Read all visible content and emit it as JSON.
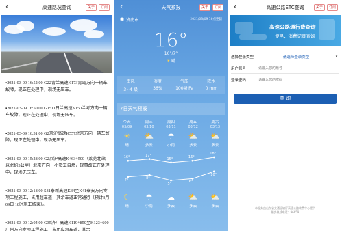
{
  "panel1": {
    "title": "高速路况查询",
    "follow_label": "关于",
    "subscribe_label": "订阅",
    "news": [
      "▪2021-03-09 16:52:00 G22青兰高速K173青岛方向一辆车故障，现正在处理中，现场无压车。",
      "▪2021-03-09 16:50:00 G1511日兰高速K150兰考方向一辆车故障，现正在处理中，现场无压车。",
      "▪2021-03-09 16:31:00 G2京沪高速K557北京方向一辆车故障，现正在处理中，现场无压车。",
      "▪2021-03-09 15:28:00 G2京沪高速K463+500（莱芜北站以北约3公里）北京方向一小货车自燃，现事故正在处理中，现场无压车。",
      "▪2021-03-09 12:18:00 S31泰新高速K34至K41泰安方向专项工程施工，占用超车道，其余车道正常通行（预计3月09日 18时施工结束）。",
      "▪2021-03-09 12:04:00 G35济广高速K119+850至K123+600广州方向专项工程施工，占用应急车道，其余"
    ]
  },
  "panel2": {
    "title": "天气预报",
    "follow_label": "关于",
    "subscribe_label": "订阅",
    "city": "济南市",
    "update_time": "2021/03/09 16点更新",
    "temp_now": "16°",
    "temp_range": "16°/7°",
    "condition": "晴",
    "stats": [
      {
        "k": "南风",
        "v": "3~4 级"
      },
      {
        "k": "湿度",
        "v": "36%"
      },
      {
        "k": "气压",
        "v": "1004hPa"
      },
      {
        "k": "降水",
        "v": "0 mm"
      }
    ],
    "forecast_title": "7日天气预报",
    "days": [
      {
        "d1": "今天",
        "d2": "03/09",
        "w": "晴",
        "icon": "sun-icon",
        "night": "晴",
        "night_icon": "moon-icon"
      },
      {
        "d1": "周三",
        "d2": "03/10",
        "w": "多云",
        "icon": "partly-cloudy-icon",
        "night": "小雨",
        "night_icon": "rain-icon"
      },
      {
        "d1": "周四",
        "d2": "03/11",
        "w": "小雨",
        "icon": "rain-icon",
        "night": "多云",
        "night_icon": "cloud-icon"
      },
      {
        "d1": "周五",
        "d2": "03/12",
        "w": "多云",
        "icon": "partly-cloudy-icon",
        "night": "多云",
        "night_icon": "partly-cloudy-icon"
      },
      {
        "d1": "周六",
        "d2": "03/13",
        "w": "多云",
        "icon": "partly-cloudy-icon",
        "night": "多云",
        "night_icon": "partly-cloudy-icon"
      }
    ],
    "highs": [
      16,
      17,
      15,
      16,
      18
    ],
    "lows": [
      7,
      8,
      5,
      6,
      10
    ],
    "high_labels": [
      "16°",
      "17°",
      "15°",
      "16°",
      "18°"
    ],
    "low_labels": [
      "7°",
      "8°",
      "5°",
      "6°",
      "10°"
    ]
  },
  "panel3": {
    "title": "高速公路ETC查询",
    "follow_label": "关于",
    "subscribe_label": "订阅",
    "banner_line1": "高速公路通行费查询",
    "banner_line2": "便民，消费记录查询",
    "rows": [
      {
        "label": "选择登录类型",
        "value": "请选择登录类型"
      },
      {
        "label": "用户账号",
        "placeholder": "请输入您的账号"
      },
      {
        "label": "登录密码",
        "placeholder": "请输入您的密码"
      }
    ],
    "query_label": "查 询",
    "footer_line1": "本服务由山东省交通运输厅高速公路收费中心提供",
    "footer_line2": "服务热线电话：96659"
  }
}
